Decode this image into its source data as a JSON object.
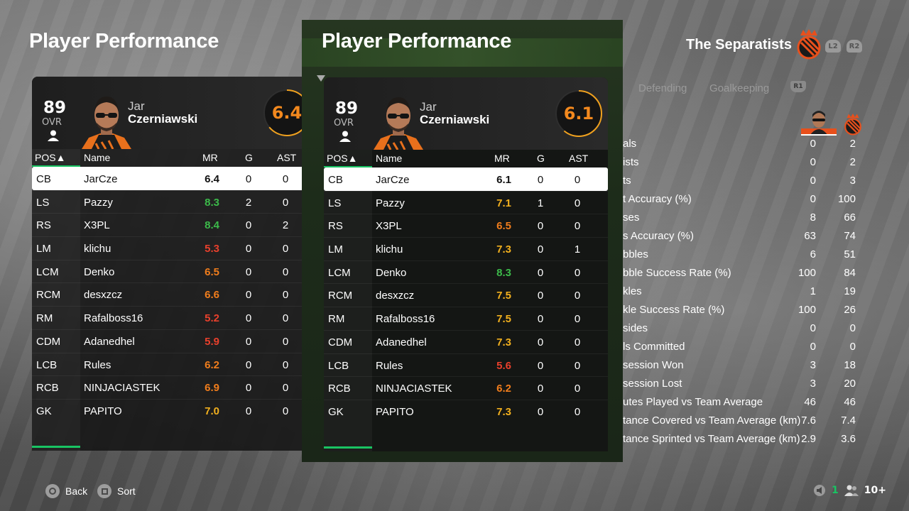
{
  "screen_title": "Player Performance",
  "team": {
    "name": "The Separatists"
  },
  "shoulder_buttons": {
    "l2": "L2",
    "r2": "R2",
    "r1": "R1"
  },
  "tabs": [
    "Defending",
    "Goalkeeping"
  ],
  "columns": {
    "pos": "POS▲",
    "name": "Name",
    "mr": "MR",
    "g": "G",
    "ast": "AST"
  },
  "panels": [
    {
      "player": {
        "ovr": "89",
        "ovr_label": "OVR",
        "first_name": "Jar",
        "last_name": "Czerniawski",
        "rating": "6.4",
        "rating_fraction": 0.64
      },
      "rows": [
        {
          "pos": "CB",
          "name": "JarCze",
          "mr": "6.4",
          "mr_color": "",
          "g": "0",
          "ast": "0",
          "selected": true
        },
        {
          "pos": "LS",
          "name": "Pazzy",
          "mr": "8.3",
          "mr_color": "green",
          "g": "2",
          "ast": "0"
        },
        {
          "pos": "RS",
          "name": "X3PL",
          "mr": "8.4",
          "mr_color": "green",
          "g": "0",
          "ast": "2"
        },
        {
          "pos": "LM",
          "name": "klichu",
          "mr": "5.3",
          "mr_color": "red",
          "g": "0",
          "ast": "0"
        },
        {
          "pos": "LCM",
          "name": "Denko",
          "mr": "6.5",
          "mr_color": "orange",
          "g": "0",
          "ast": "0"
        },
        {
          "pos": "RCM",
          "name": "desxzcz",
          "mr": "6.6",
          "mr_color": "orange",
          "g": "0",
          "ast": "0"
        },
        {
          "pos": "RM",
          "name": "Rafalboss16",
          "mr": "5.2",
          "mr_color": "red",
          "g": "0",
          "ast": "0"
        },
        {
          "pos": "CDM",
          "name": "Adanedhel",
          "mr": "5.9",
          "mr_color": "red",
          "g": "0",
          "ast": "0"
        },
        {
          "pos": "LCB",
          "name": "Rules",
          "mr": "6.2",
          "mr_color": "orange",
          "g": "0",
          "ast": "0"
        },
        {
          "pos": "RCB",
          "name": "NINJACIASTEK",
          "mr": "6.9",
          "mr_color": "orange",
          "g": "0",
          "ast": "0"
        },
        {
          "pos": "GK",
          "name": "PAPITO",
          "mr": "7.0",
          "mr_color": "yellow",
          "g": "0",
          "ast": "0"
        }
      ]
    },
    {
      "player": {
        "ovr": "89",
        "ovr_label": "OVR",
        "first_name": "Jar",
        "last_name": "Czerniawski",
        "rating": "6.1",
        "rating_fraction": 0.61
      },
      "rows": [
        {
          "pos": "CB",
          "name": "JarCze",
          "mr": "6.1",
          "mr_color": "",
          "g": "0",
          "ast": "0",
          "selected": true
        },
        {
          "pos": "LS",
          "name": "Pazzy",
          "mr": "7.1",
          "mr_color": "yellow",
          "g": "1",
          "ast": "0"
        },
        {
          "pos": "RS",
          "name": "X3PL",
          "mr": "6.5",
          "mr_color": "orange",
          "g": "0",
          "ast": "0"
        },
        {
          "pos": "LM",
          "name": "klichu",
          "mr": "7.3",
          "mr_color": "yellow",
          "g": "0",
          "ast": "1"
        },
        {
          "pos": "LCM",
          "name": "Denko",
          "mr": "8.3",
          "mr_color": "green",
          "g": "0",
          "ast": "0"
        },
        {
          "pos": "RCM",
          "name": "desxzcz",
          "mr": "7.5",
          "mr_color": "yellow",
          "g": "0",
          "ast": "0"
        },
        {
          "pos": "RM",
          "name": "Rafalboss16",
          "mr": "7.5",
          "mr_color": "yellow",
          "g": "0",
          "ast": "0"
        },
        {
          "pos": "CDM",
          "name": "Adanedhel",
          "mr": "7.3",
          "mr_color": "yellow",
          "g": "0",
          "ast": "0"
        },
        {
          "pos": "LCB",
          "name": "Rules",
          "mr": "5.6",
          "mr_color": "red",
          "g": "0",
          "ast": "0"
        },
        {
          "pos": "RCB",
          "name": "NINJACIASTEK",
          "mr": "6.2",
          "mr_color": "orange",
          "g": "0",
          "ast": "0"
        },
        {
          "pos": "GK",
          "name": "PAPITO",
          "mr": "7.3",
          "mr_color": "yellow",
          "g": "0",
          "ast": "0"
        }
      ]
    }
  ],
  "stats": [
    {
      "label": "als",
      "player": "0",
      "team": "2"
    },
    {
      "label": "ists",
      "player": "0",
      "team": "2"
    },
    {
      "label": "ts",
      "player": "0",
      "team": "3"
    },
    {
      "label": "t Accuracy (%)",
      "player": "0",
      "team": "100"
    },
    {
      "label": "ses",
      "player": "8",
      "team": "66"
    },
    {
      "label": "s Accuracy (%)",
      "player": "63",
      "team": "74"
    },
    {
      "label": "bbles",
      "player": "6",
      "team": "51"
    },
    {
      "label": "bble Success Rate (%)",
      "player": "100",
      "team": "84"
    },
    {
      "label": "kles",
      "player": "1",
      "team": "19"
    },
    {
      "label": "kle Success Rate (%)",
      "player": "100",
      "team": "26"
    },
    {
      "label": "sides",
      "player": "0",
      "team": "0"
    },
    {
      "label": "ls Committed",
      "player": "0",
      "team": "0"
    },
    {
      "label": "session Won",
      "player": "3",
      "team": "18"
    },
    {
      "label": "session Lost",
      "player": "3",
      "team": "20"
    },
    {
      "label": "utes Played vs Team Average",
      "player": "46",
      "team": "46"
    },
    {
      "label": "tance Covered vs Team Average (km)",
      "player": "7.6",
      "team": "7.4"
    },
    {
      "label": "tance Sprinted vs Team Average (km)",
      "player": "2.9",
      "team": "3.6"
    }
  ],
  "footer": {
    "back": "Back",
    "sort": "Sort",
    "count": "1",
    "players": "10+"
  },
  "colors": {
    "accent_green": "#19c463",
    "rating_orange": "#f3891e",
    "team_orange": "#e8501c"
  }
}
